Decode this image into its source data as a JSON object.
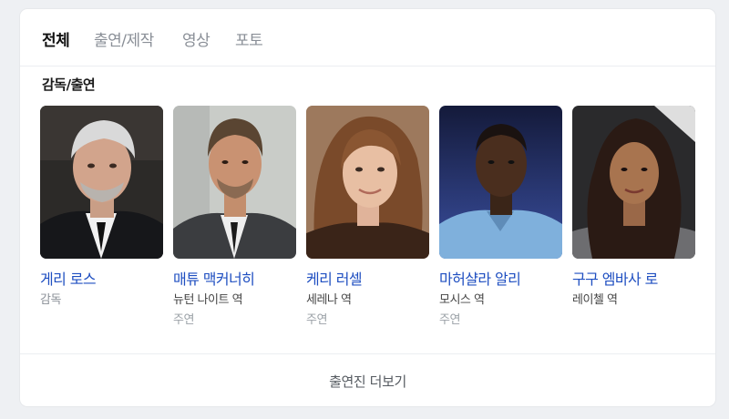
{
  "tabs": [
    {
      "label": "전체",
      "active": true
    },
    {
      "label": "출연/제작",
      "active": false
    },
    {
      "label": "영상",
      "active": false
    },
    {
      "label": "포토",
      "active": false
    }
  ],
  "section_title": "감독/출연",
  "people": [
    {
      "name": "게리 로스",
      "role": "감독",
      "type": ""
    },
    {
      "name": "매튜 맥커너히",
      "role": "뉴턴 나이트 역",
      "type": "주연"
    },
    {
      "name": "케리 러셀",
      "role": "세레나 역",
      "type": "주연"
    },
    {
      "name": "마허샬라 알리",
      "role": "모시스 역",
      "type": "주연"
    },
    {
      "name": "구구 엠바사 로",
      "role": "레이첼 역",
      "type": ""
    }
  ],
  "more_label": "출연진 더보기",
  "colors": {
    "link": "#1f4fc1",
    "active_tab": "#111111",
    "inactive_tab": "#8a8f97"
  }
}
